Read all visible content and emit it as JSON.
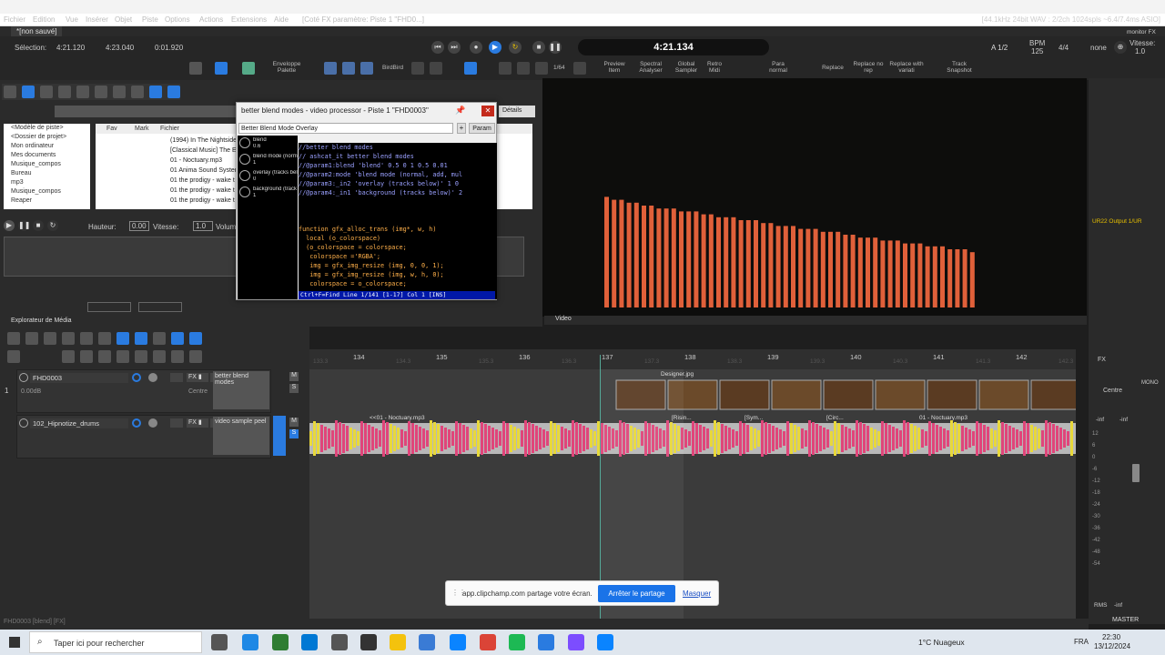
{
  "menubar": {
    "items": [
      "Fichier",
      "Edition",
      "Vue",
      "Insérer",
      "Objet",
      "Piste",
      "Options",
      "Actions",
      "Extensions",
      "Aide"
    ],
    "project_info": "[Coté FX paramètre: Piste 1 \"FHD0...]",
    "audio_info": "[44.1kHz 24bit WAV : 2/2ch 1024spls ~6.4/7.4ms ASIO]"
  },
  "project_tab": "*[non sauvé]",
  "selection": {
    "label": "Sélection:",
    "start": "4:21.120",
    "end": "4:23.040",
    "length": "0:01.920"
  },
  "transport": {
    "time": "4:21.134",
    "marker": "A 1/2",
    "bpm_label": "BPM",
    "bpm": "125",
    "signature": "4/4",
    "snap": "none",
    "speed_label": "Vitesse:",
    "speed": "1.0",
    "monitor_fx": "monitor FX"
  },
  "toolbar": {
    "envelope": "Enveloppe Palette",
    "birdbird": "BirdBird",
    "grid": "1/64",
    "items": [
      "Preview Item",
      "Spectral Analyser",
      "Global Sampler",
      "Retro Midi",
      "Para normal",
      "Replace",
      "Replace no rep",
      "Replace with variati",
      "Track Snapshot"
    ]
  },
  "media": {
    "details": "Détails",
    "tree": [
      "<Modèle de piste>",
      "<Dossier de projet>",
      "Mon ordinateur",
      "Mes documents",
      "Musique_compos",
      "Bureau",
      "mp3",
      "Musique_compos",
      "Reaper"
    ],
    "columns": [
      "Fav",
      "Mark",
      "Fichier"
    ],
    "files": [
      "(1994) In The Nightside",
      "[Classical Music] The E",
      "01 - Noctuary.mp3",
      "01 Anima Sound Syster",
      "01 the prodigy - wake t",
      "01 the prodigy - wake t",
      "01 the prodigy - wake t"
    ],
    "height_label": "Hauteur:",
    "height_value": "0.00",
    "speed_label": "Vitesse:",
    "speed_value": "1.0",
    "volume_label": "Volume",
    "tab": "Explorateur de Média"
  },
  "dialog": {
    "title": "better blend modes - video processor - Piste 1 \"FHD0003\"",
    "preset": "Better Blend Mode Overlay",
    "param_button": "Param",
    "sliders": [
      {
        "name": "blend",
        "value": "0.6"
      },
      {
        "name": "blend mode (norm",
        "value": "1"
      },
      {
        "name": "overlay (tracks bel",
        "value": "0"
      },
      {
        "name": "background (track",
        "value": "1"
      }
    ],
    "code": [
      "//better blend modes",
      "// ashcat_it better blend modes",
      "//@param1:blend 'blend' 0.5 0 1 0.5 0.01",
      "//@param2:mode 'blend mode (normal, add, mul",
      "//@param3:_in2 'overlay (tracks below)' 1 0",
      "//@param4:_in1 'background (tracks below)' 2",
      "",
      "",
      "",
      "function gfx_alloc_trans (img*, w, h)",
      "  local (o_colorspace)",
      "  (o_colorspace = colorspace;",
      "   colorspace ='RGBA';",
      "   img = gfx_img_resize (img, 0, 0, 1);",
      "   img = gfx_img_resize (img, w, h, 0);",
      "   colorspace = o_colorspace;"
    ],
    "status": "Ctrl+F=Find Line 1/141 [1-17] Col 1 [INS]"
  },
  "video": {
    "label": "Video",
    "bars": [
      38,
      37,
      37,
      36,
      36,
      35,
      35,
      34,
      34,
      34,
      33,
      33,
      33,
      32,
      32,
      31,
      31,
      31,
      30,
      30,
      30,
      29,
      29,
      28,
      28,
      28,
      27,
      27,
      27,
      26,
      26,
      26,
      25,
      25,
      24,
      24,
      24,
      23,
      23,
      23,
      22,
      22,
      22,
      21,
      21,
      21,
      20,
      20,
      20,
      19
    ]
  },
  "tracks": [
    {
      "num": "1",
      "name": "FHD0003",
      "fx_label": "better blend modes",
      "volume": "0.00dB",
      "pan": "Centre",
      "m": "M",
      "s": "S"
    },
    {
      "num": "",
      "name": "102_Hipnotize_drums",
      "fx_label": "video sample peel",
      "m": "M",
      "s": "S"
    }
  ],
  "ruler": {
    "marks": [
      "134",
      "135",
      "136",
      "137",
      "138",
      "139",
      "140",
      "141",
      "142"
    ],
    "subs": [
      "133.3",
      "134.3",
      "135.3",
      "136.3",
      "137.3",
      "138.3",
      "139.3",
      "140.3",
      "141.3",
      "142.3"
    ]
  },
  "items": {
    "video": "Designer.jpg",
    "audio1": "<<01 - Noctuary.mp3",
    "audio2": "01 - Noctuary.mp3",
    "item_tags": [
      "[Risin...",
      "[Sym...",
      "[Circ..."
    ]
  },
  "mixer": {
    "output": "UR22 Output 1/UR",
    "fx": "FX",
    "pan": "Centre",
    "inf": "-inf",
    "scale": [
      "12",
      "6",
      "0",
      "-6",
      "-12",
      "-18",
      "-24",
      "-30",
      "-36",
      "-42",
      "-48",
      "-54"
    ],
    "rms": "RMS",
    "master": "MASTER",
    "mono": "MONO"
  },
  "share": {
    "text": "app.clipchamp.com partage votre écran.",
    "stop": "Arrêter le partage",
    "hide": "Masquer"
  },
  "statusbar": "FHD0003 [blend] [FX]",
  "taskbar": {
    "search": "Taper ici pour rechercher",
    "weather": "1°C Nuageux",
    "lang": "FRA",
    "time": "22:30",
    "date": "13/12/2024"
  },
  "colors": {
    "bars": "#e0603a",
    "audio_pink": "#e0457a",
    "audio_yellow": "#e8d83a",
    "accent": "#1a73e8",
    "code_comment": "#9aa0ff",
    "code_text": "#ffb04a"
  }
}
